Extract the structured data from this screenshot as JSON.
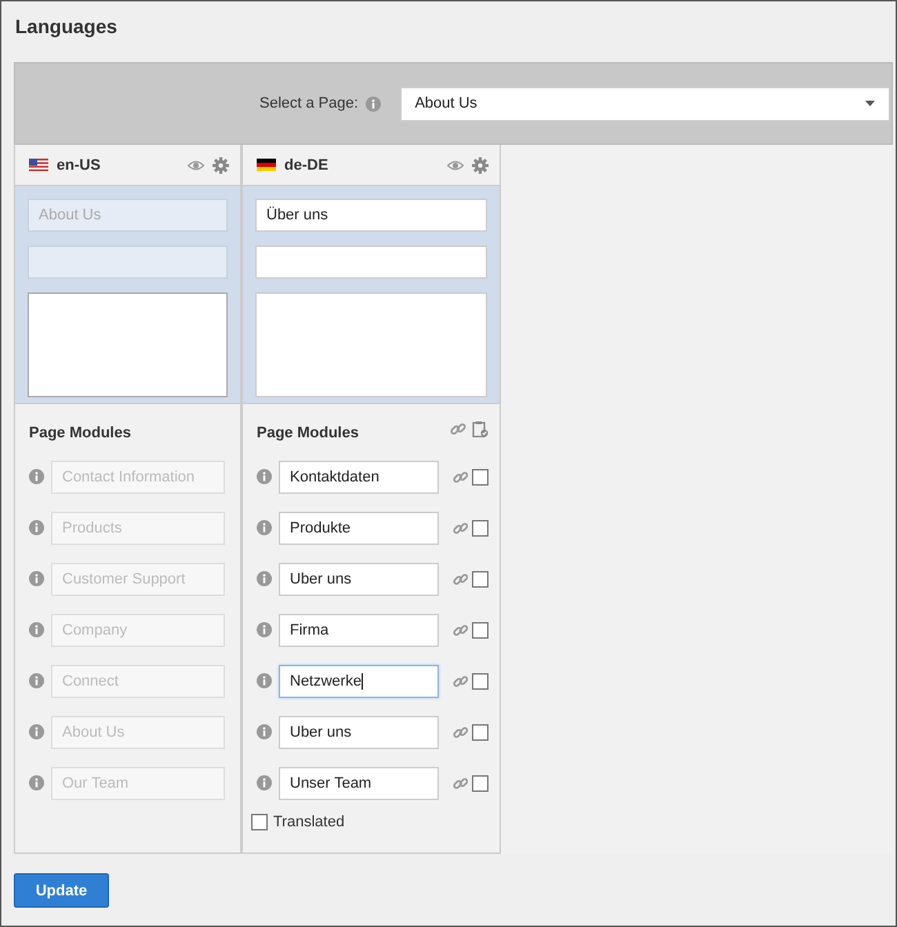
{
  "title": "Languages",
  "page_select": {
    "label": "Select a Page:",
    "value": "About Us"
  },
  "languages": [
    {
      "code": "en-US",
      "kind": "source",
      "title_value": "About Us",
      "modules_heading": "Page Modules",
      "modules": [
        {
          "value": "Contact Information"
        },
        {
          "value": "Products"
        },
        {
          "value": "Customer Support"
        },
        {
          "value": "Company"
        },
        {
          "value": "Connect"
        },
        {
          "value": "About Us"
        },
        {
          "value": "Our Team"
        }
      ]
    },
    {
      "code": "de-DE",
      "kind": "translation",
      "title_value": "Über uns",
      "modules_heading": "Page Modules",
      "modules": [
        {
          "value": "Kontaktdaten",
          "focused": false,
          "checked": false
        },
        {
          "value": "Produkte",
          "focused": false,
          "checked": false
        },
        {
          "value": "Uber uns",
          "focused": false,
          "checked": false
        },
        {
          "value": "Firma",
          "focused": false,
          "checked": false
        },
        {
          "value": "Netzwerke",
          "focused": true,
          "checked": false
        },
        {
          "value": "Uber uns",
          "focused": false,
          "checked": false
        },
        {
          "value": "Unser Team",
          "focused": false,
          "checked": false
        }
      ],
      "translated": {
        "label": "Translated",
        "checked": false
      }
    }
  ],
  "update_button": "Update"
}
